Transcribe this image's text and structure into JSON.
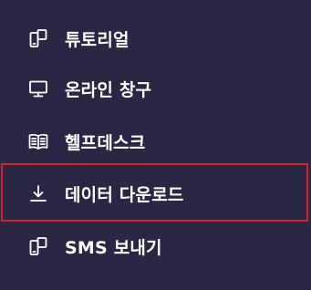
{
  "menu": {
    "items": [
      {
        "label": "튜토리얼",
        "icon": "mobile-devices-icon"
      },
      {
        "label": "온라인 창구",
        "icon": "monitor-icon"
      },
      {
        "label": "헬프데스크",
        "icon": "book-open-icon"
      },
      {
        "label": "데이터 다운로드",
        "icon": "download-icon"
      },
      {
        "label": "SMS 보내기",
        "icon": "mobile-devices-icon"
      }
    ],
    "highlighted_item": "데이터 다운로드"
  },
  "colors": {
    "background": "#2a2745",
    "text": "#ffffff",
    "highlight_border": "#d2222d"
  }
}
